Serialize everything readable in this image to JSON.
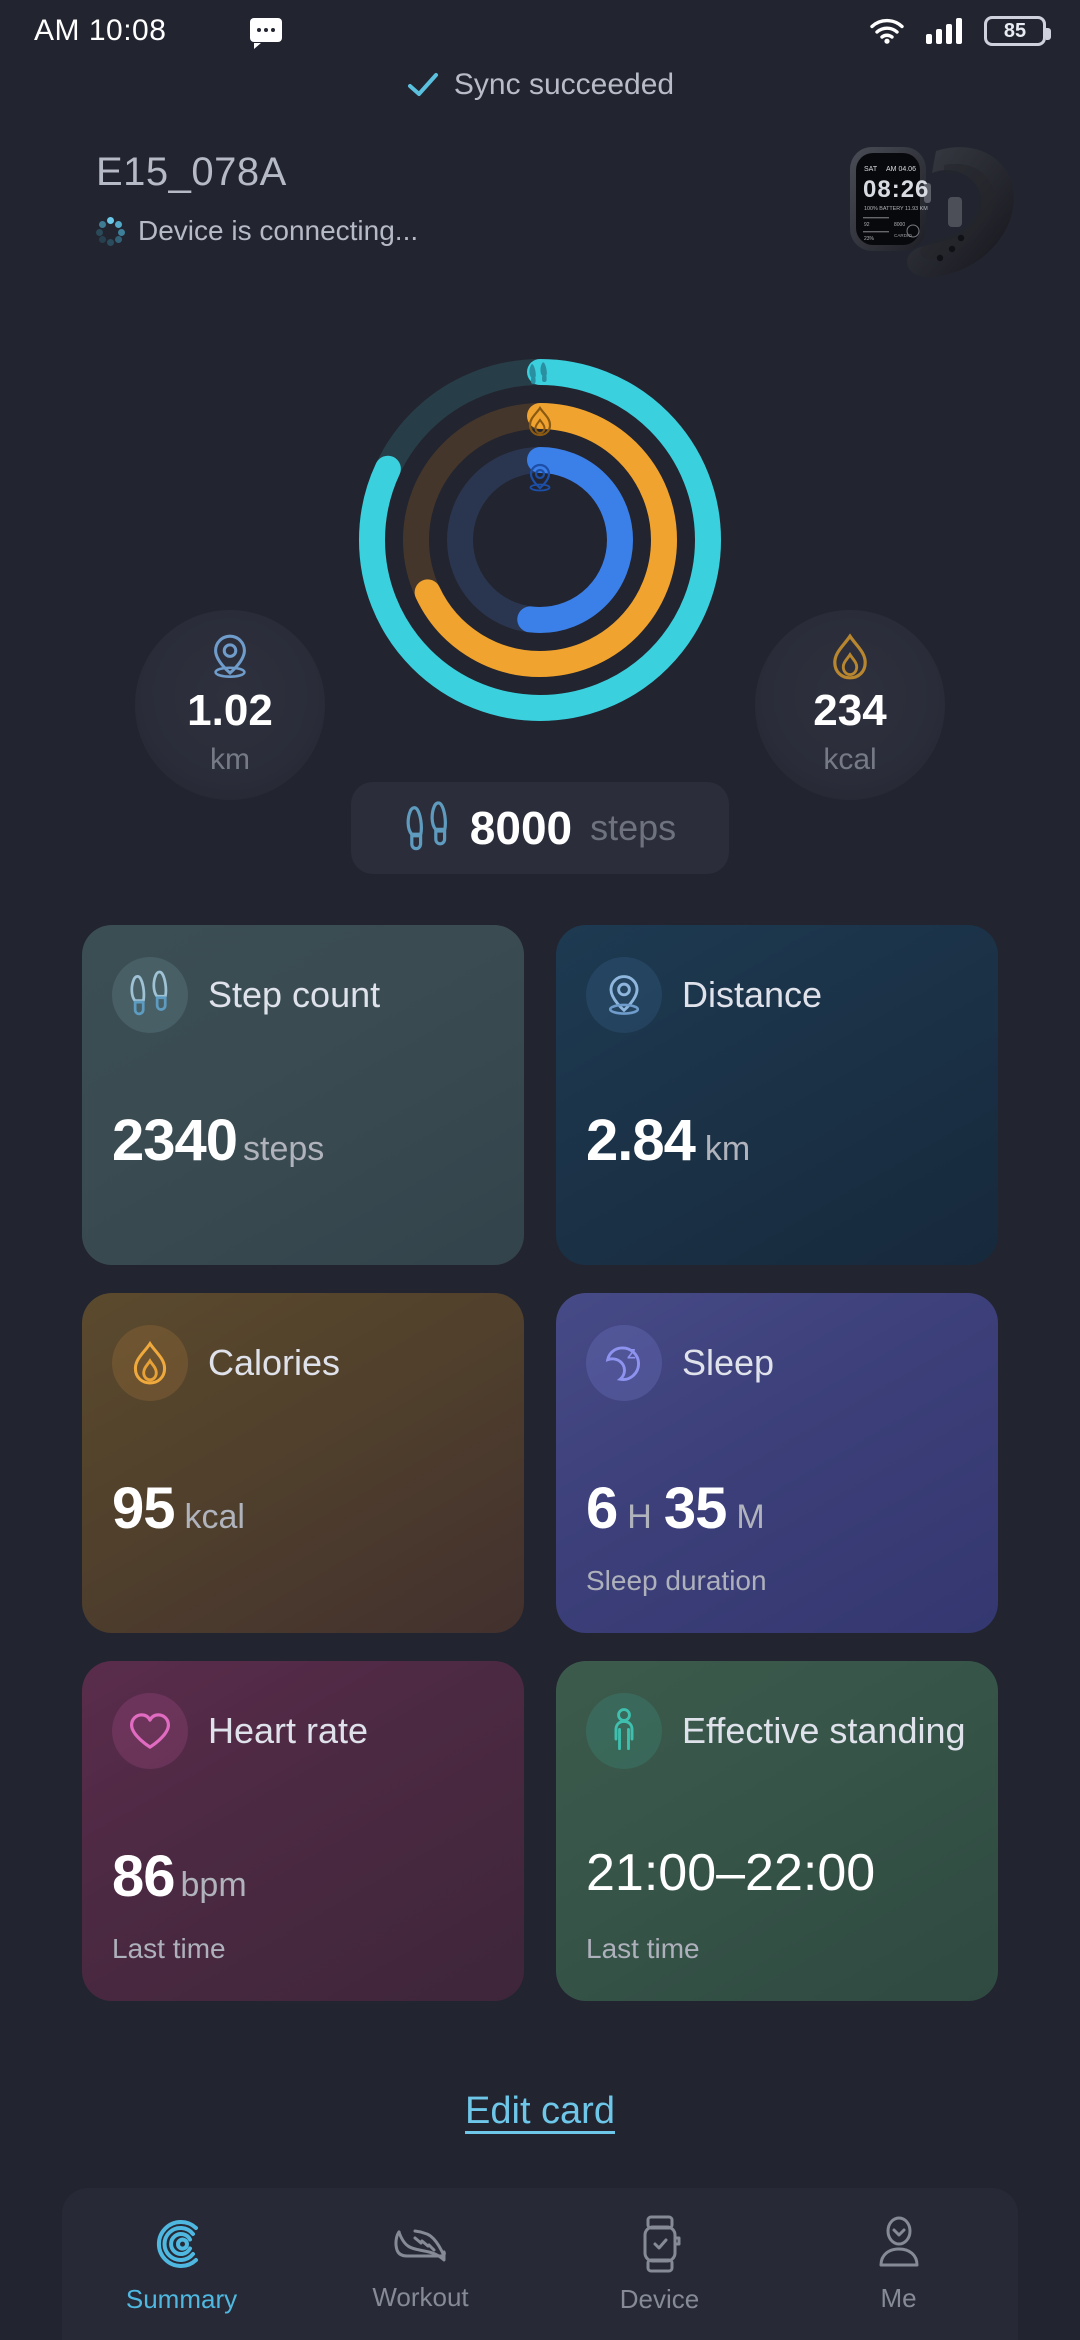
{
  "status_bar": {
    "time": "AM 10:08",
    "message_icon": "message-bubble-icon",
    "wifi_icon": "wifi-icon",
    "signal_icon": "signal-bars-icon",
    "battery_level": "85",
    "battery_icon": "battery-icon"
  },
  "sync": {
    "icon": "check-icon",
    "label": "Sync succeeded",
    "accent": "#5bc0de"
  },
  "device": {
    "name": "E15_078A",
    "status": "Device is connecting...",
    "spinner_icon": "loading-spinner-icon",
    "product_image": "smartwatch-image",
    "watch_face_time": "08:26"
  },
  "rings": {
    "steps": {
      "icon": "footprints-icon",
      "color": "#3ad0dd",
      "track": "#2a4550",
      "percent": 82
    },
    "calories": {
      "icon": "flame-icon",
      "color": "#f0a32e",
      "track": "#4a3a2a",
      "percent": 68
    },
    "distance": {
      "icon": "location-pin-icon",
      "color": "#3b7fe8",
      "track": "#2b3a55",
      "percent": 52
    }
  },
  "summary_stats": {
    "distance": {
      "icon": "location-pin-icon",
      "value": "1.02",
      "unit": "km"
    },
    "calories": {
      "icon": "flame-icon",
      "value": "234",
      "unit": "kcal"
    },
    "steps": {
      "icon": "footprints-icon",
      "value": "8000",
      "unit": "steps"
    }
  },
  "cards": [
    {
      "id": "step-count",
      "icon": "footprints-icon",
      "title": "Step count",
      "value": "2340",
      "unit": "steps",
      "sub": ""
    },
    {
      "id": "distance",
      "icon": "location-pin-icon",
      "title": "Distance",
      "value": "2.84",
      "unit": "km",
      "sub": ""
    },
    {
      "id": "calories",
      "icon": "flame-icon",
      "title": "Calories",
      "value": "95",
      "unit": "kcal",
      "sub": ""
    },
    {
      "id": "sleep",
      "icon": "moon-sleep-icon",
      "title": "Sleep",
      "value": "6",
      "unit": "H",
      "value2": "35",
      "unit2": "M",
      "sub": "Sleep duration"
    },
    {
      "id": "heart-rate",
      "icon": "heart-icon",
      "title": "Heart rate",
      "value": "86",
      "unit": "bpm",
      "sub": "Last time"
    },
    {
      "id": "effective-standing",
      "icon": "standing-person-icon",
      "title": "Effective standing",
      "value": "21:00–22:00",
      "unit": "",
      "sub": "Last time"
    }
  ],
  "edit_card": {
    "label": "Edit card"
  },
  "bottom_nav": {
    "items": [
      {
        "label": "Summary",
        "icon": "summary-spiral-icon",
        "active": true
      },
      {
        "label": "Workout",
        "icon": "running-shoe-icon",
        "active": false
      },
      {
        "label": "Device",
        "icon": "watch-icon",
        "active": false
      },
      {
        "label": "Me",
        "icon": "person-icon",
        "active": false
      }
    ],
    "active_color": "#4fb8e0"
  }
}
